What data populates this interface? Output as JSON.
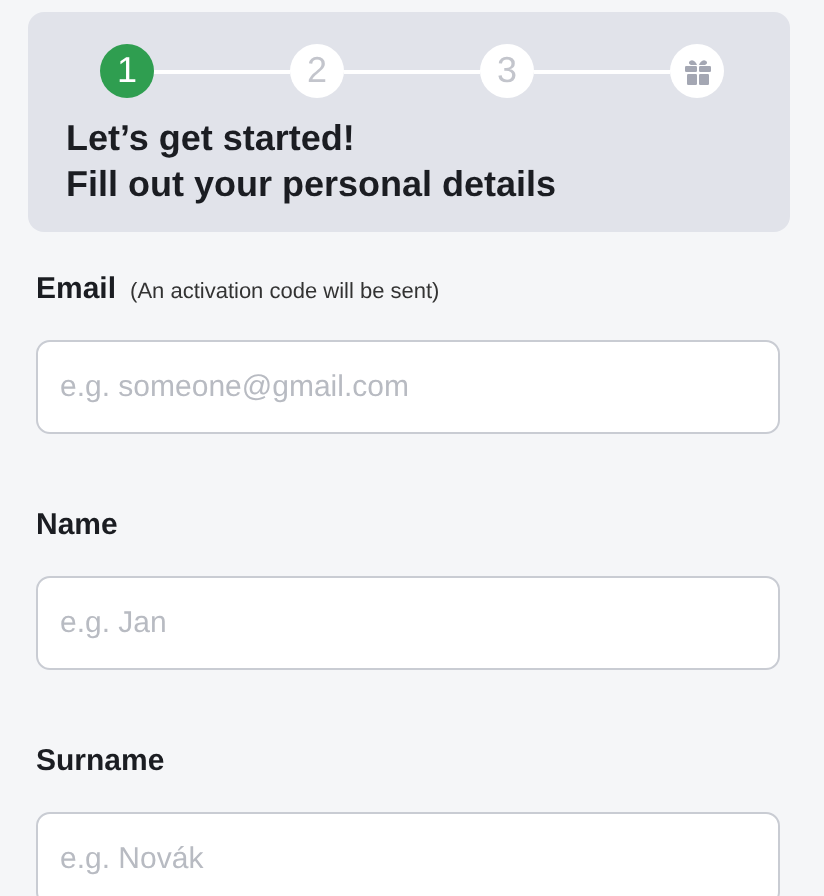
{
  "steps": [
    {
      "kind": "number",
      "label": "1",
      "selected": true
    },
    {
      "kind": "number",
      "label": "2",
      "selected": false
    },
    {
      "kind": "number",
      "label": "3",
      "selected": false
    },
    {
      "kind": "gift",
      "selected": false
    }
  ],
  "heading": [
    "Let’s get started!",
    "Fill out your personal details"
  ],
  "fields": [
    {
      "label": "Email",
      "hint": "(An activation code will be sent)",
      "placeholder": "e.g. someone@gmail.com"
    },
    {
      "label": "Name",
      "placeholder": "e.g. Jan"
    },
    {
      "label": "Surname",
      "placeholder": "e.g. Novák"
    }
  ]
}
